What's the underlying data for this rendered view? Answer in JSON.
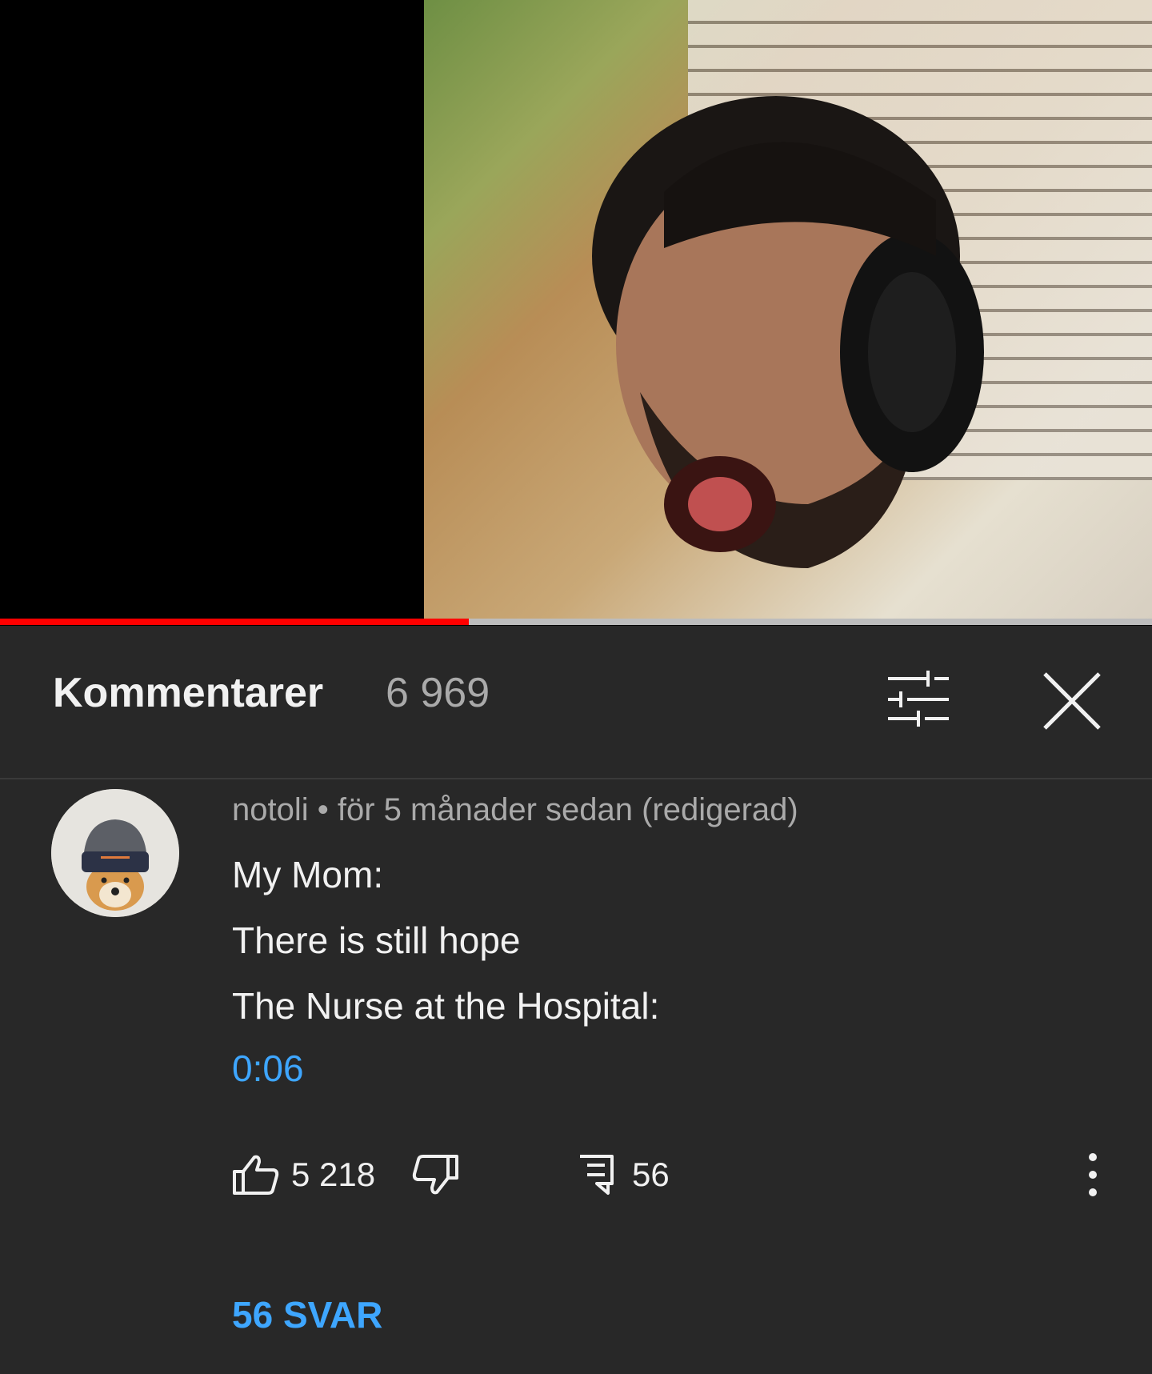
{
  "video": {
    "progress_fraction": 0.407
  },
  "comments_header": {
    "title": "Kommentarer",
    "count": "6 969",
    "filter_icon": "tune-icon",
    "close_icon": "close-icon"
  },
  "comment": {
    "author": "notoli",
    "separator": " • ",
    "time": "för 5 månader sedan (redigerad)",
    "lines": [
      "My Mom:",
      "There is still hope",
      "The Nurse at the Hospital:"
    ],
    "timestamp": "0:06",
    "likes": "5 218",
    "replies_count": "56",
    "view_replies": "56 SVAR"
  },
  "colors": {
    "background": "#282828",
    "accent_link": "#3ea6ff",
    "progress": "#ff0000"
  }
}
